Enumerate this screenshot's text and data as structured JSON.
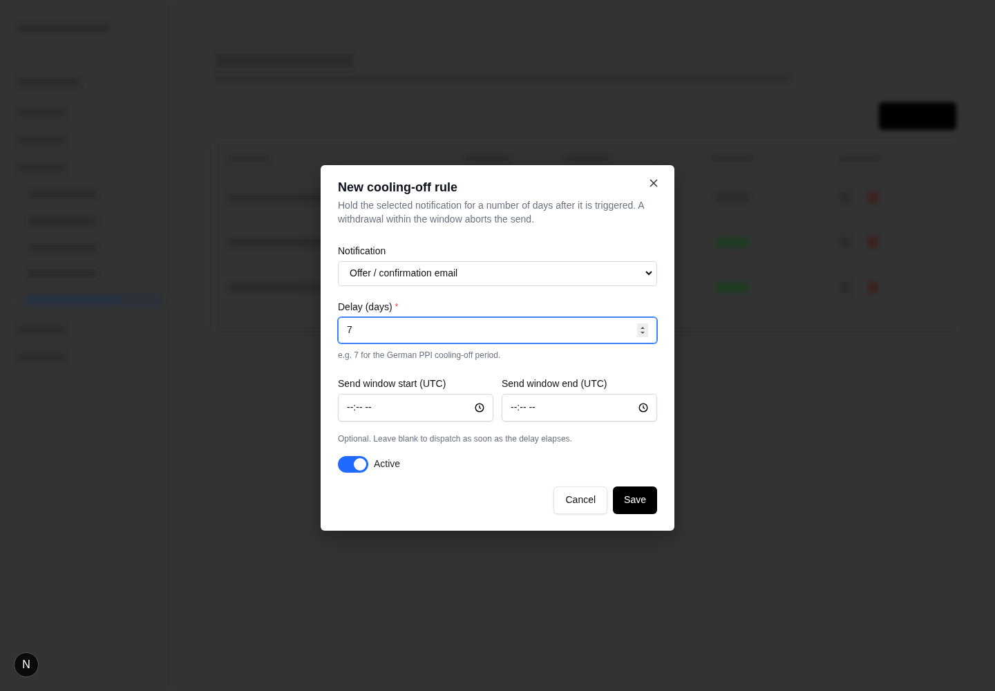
{
  "dev_badge": "N",
  "dialog": {
    "title": "New cooling-off rule",
    "description": "Hold the selected notification for a number of days after it is triggered. A withdrawal within the window aborts the send.",
    "notification": {
      "label": "Notification",
      "value": "Offer / confirmation email"
    },
    "delay": {
      "label": "Delay (days)",
      "required_mark": "*",
      "value": "7",
      "focused": true,
      "help": "e.g. 7 for the German PPI cooling-off period."
    },
    "window_fields": [
      {
        "label": "Send window start (UTC)",
        "placeholder": "--:-- --"
      },
      {
        "label": "Send window end (UTC)",
        "placeholder": "--:-- --"
      }
    ],
    "window_help": "Optional. Leave blank to dispatch as soon as the delay elapses.",
    "active": {
      "label": "Active",
      "on": true
    },
    "buttons": [
      {
        "label": "Cancel",
        "kind": "secondary"
      },
      {
        "label": "Save",
        "kind": "primary"
      }
    ]
  }
}
